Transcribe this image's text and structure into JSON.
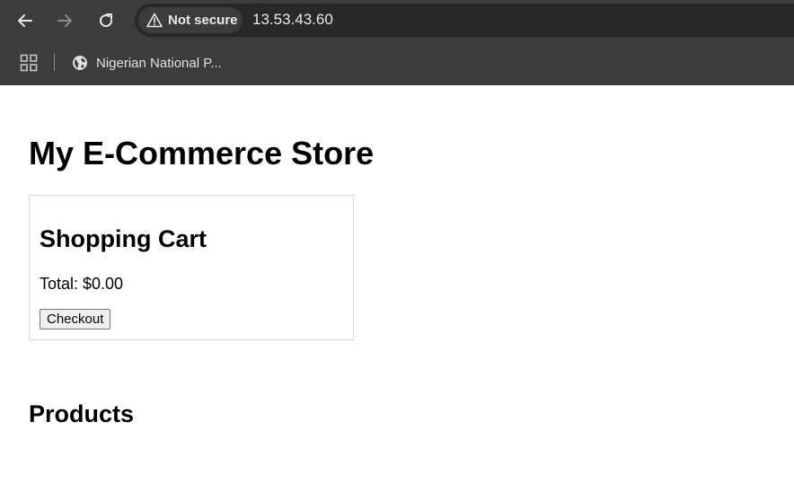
{
  "browser": {
    "security_label": "Not secure",
    "url": "13.53.43.60",
    "bookmarks": [
      {
        "label": "Nigerian National P...",
        "icon": "globe-icon"
      }
    ],
    "icons": {
      "back": "back-arrow-icon",
      "forward": "forward-arrow-icon",
      "reload": "reload-icon",
      "security": "warning-triangle-icon",
      "apps": "apps-grid-icon"
    },
    "colors": {
      "chrome_background": "#3c3c3c",
      "omnibox_background": "#282828",
      "chrome_text": "#e8eaed"
    }
  },
  "page": {
    "title": "My E-Commerce Store",
    "cart": {
      "title": "Shopping Cart",
      "total": "Total: $0.00",
      "checkout_label": "Checkout"
    },
    "products_title": "Products"
  }
}
